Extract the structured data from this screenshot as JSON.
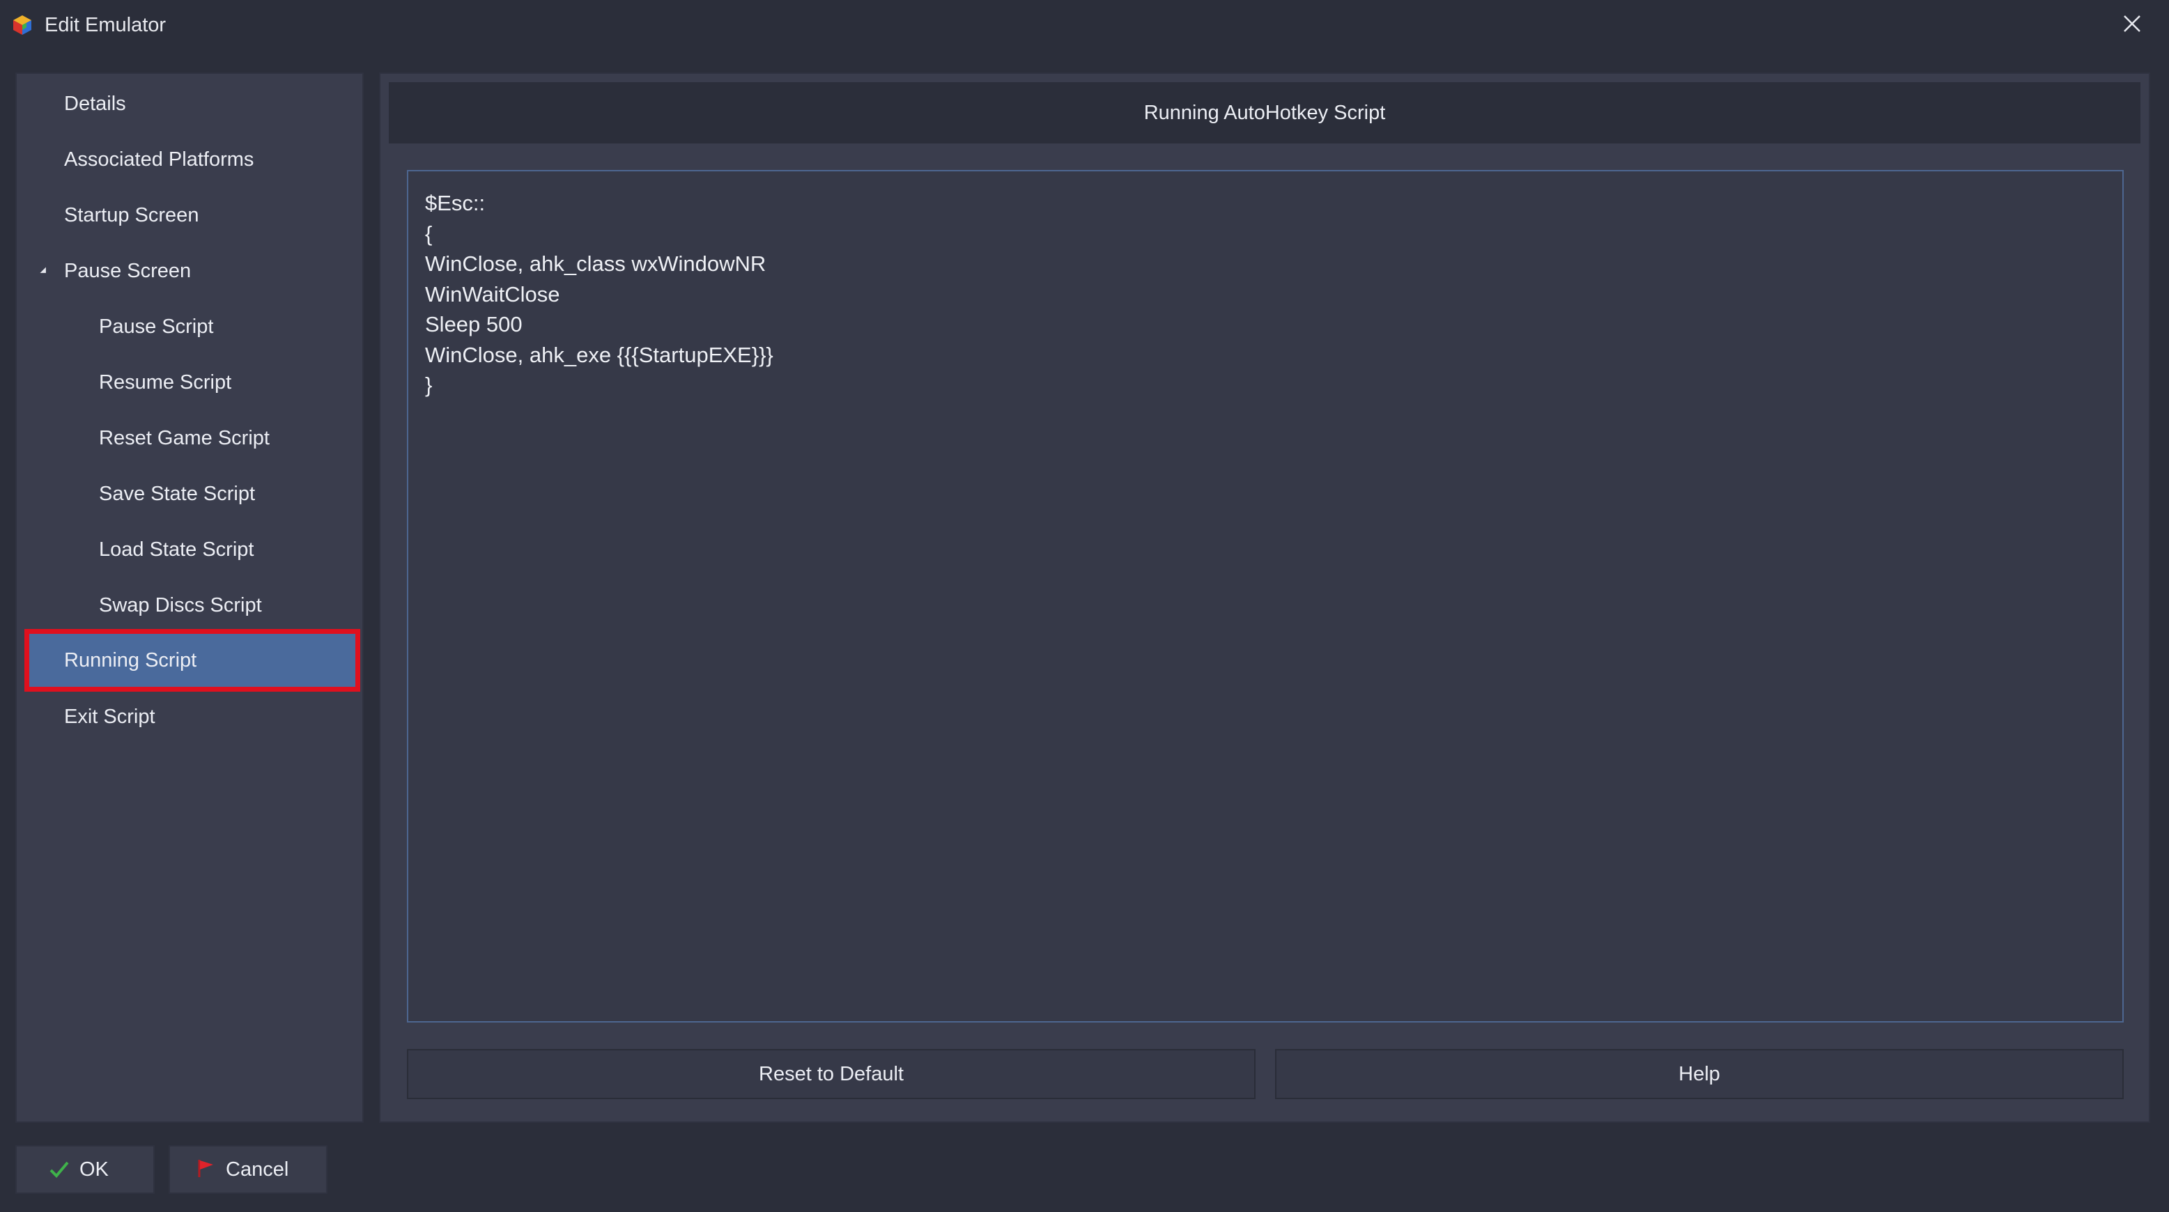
{
  "window": {
    "title": "Edit Emulator",
    "icon": "launchbox-app-icon",
    "close_icon": "close-icon"
  },
  "sidebar": {
    "items": [
      {
        "label": "Details",
        "level": 1
      },
      {
        "label": "Associated Platforms",
        "level": 1
      },
      {
        "label": "Startup Screen",
        "level": 1
      },
      {
        "label": "Pause Screen",
        "level": 1,
        "expanded": true
      },
      {
        "label": "Pause Script",
        "level": 2
      },
      {
        "label": "Resume Script",
        "level": 2
      },
      {
        "label": "Reset Game Script",
        "level": 2
      },
      {
        "label": "Save State Script",
        "level": 2
      },
      {
        "label": "Load State Script",
        "level": 2
      },
      {
        "label": "Swap Discs Script",
        "level": 2
      },
      {
        "label": "Running Script",
        "level": 1,
        "selected": true
      },
      {
        "label": "Exit Script",
        "level": 1
      }
    ]
  },
  "main": {
    "header": "Running AutoHotkey Script",
    "script": "$Esc::\n{\nWinClose, ahk_class wxWindowNR\nWinWaitClose\nSleep 500\nWinClose, ahk_exe {{{StartupEXE}}}\n}",
    "reset_label": "Reset to Default",
    "help_label": "Help"
  },
  "footer": {
    "ok_label": "OK",
    "cancel_label": "Cancel",
    "ok_icon": "checkmark-icon",
    "cancel_icon": "red-flag-icon"
  },
  "colors": {
    "background": "#2b2e3a",
    "panel": "#3a3d4d",
    "selection": "#4a6a9c",
    "highlight_box": "#e0101e",
    "editor_border": "#4d6690"
  }
}
